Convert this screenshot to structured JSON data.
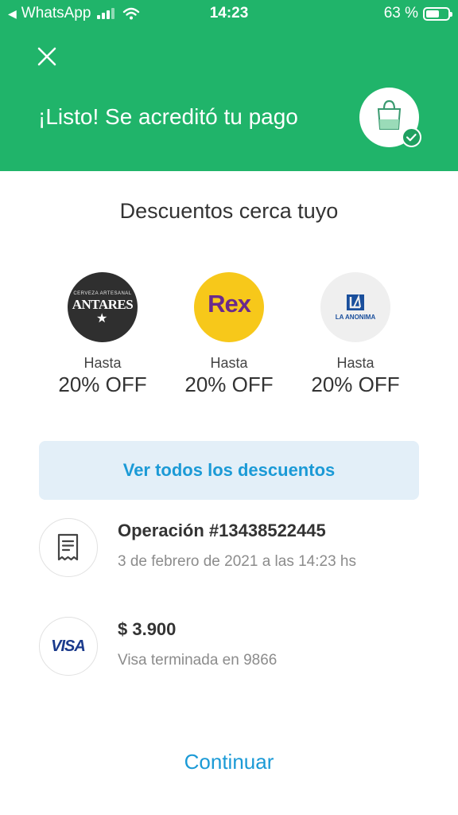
{
  "status_bar": {
    "back_app": "WhatsApp",
    "time": "14:23",
    "battery_percent": "63 %",
    "battery_level": 0.63
  },
  "header": {
    "title": "¡Listo! Se acreditó tu pago",
    "background_color": "#20b46a"
  },
  "discounts": {
    "title": "Descuentos cerca tuyo",
    "merchants": [
      {
        "logo_text": "ANTARES",
        "logo_subtext": "CERVEZA ARTESANAL",
        "hasta": "Hasta",
        "off": "20% OFF"
      },
      {
        "logo_text": "Rex",
        "hasta": "Hasta",
        "off": "20% OFF"
      },
      {
        "logo_text": "LA ANONIMA",
        "hasta": "Hasta",
        "off": "20% OFF"
      }
    ],
    "see_all_label": "Ver todos los descuentos"
  },
  "operation": {
    "title": "Operación #13438522445",
    "date": "3 de febrero de 2021 a las 14:23 hs",
    "icon": "receipt-icon"
  },
  "payment": {
    "amount": "$ 3.900",
    "card": "Visa terminada en 9866",
    "brand": "VISA"
  },
  "continue_label": "Continuar",
  "accent_color": "#1b9ad6"
}
